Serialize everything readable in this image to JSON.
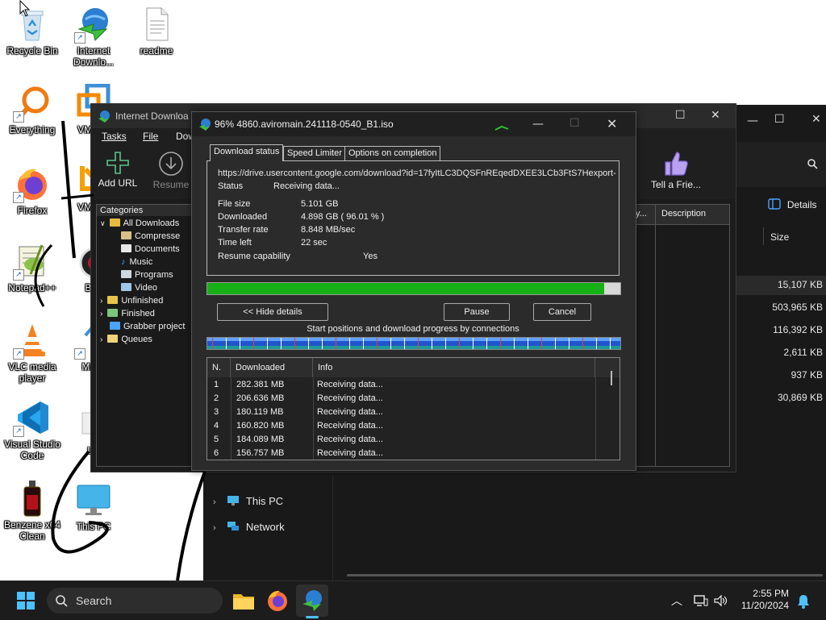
{
  "desktop": {
    "icons": [
      {
        "label": "Recycle Bin"
      },
      {
        "label": "Internet Downlo..."
      },
      {
        "label": "readme"
      },
      {
        "label": "Everything"
      },
      {
        "label": "VMWor"
      },
      {
        "label": "Firefox"
      },
      {
        "label": "VMWor"
      },
      {
        "label": "Notepad++"
      },
      {
        "label": "Ban"
      },
      {
        "label": "VLC media player"
      },
      {
        "label": "Maku"
      },
      {
        "label": "Visual Studio Code"
      },
      {
        "label": "Un"
      },
      {
        "label": "Benzene x64 Clean"
      },
      {
        "label": "This PC"
      }
    ]
  },
  "explorer": {
    "details_label": "Details",
    "size_header": "Size",
    "sizes": [
      "15,107 KB",
      "503,965 KB",
      "116,392 KB",
      "2,611 KB",
      "937 KB",
      "30,869 KB"
    ],
    "nav": [
      {
        "label": "This PC"
      },
      {
        "label": "Network"
      }
    ]
  },
  "idm": {
    "title": "Internet Downloa",
    "menu": [
      "Tasks",
      "File",
      "Dow"
    ],
    "toolbar": {
      "add_url": "Add URL",
      "resume": "Resume",
      "tell_friend": "Tell a Frie..."
    },
    "categories": {
      "header": "Categories",
      "items": [
        {
          "label": "All Downloads"
        },
        {
          "label": "Compresse"
        },
        {
          "label": "Documents"
        },
        {
          "label": "Music"
        },
        {
          "label": "Programs"
        },
        {
          "label": "Video"
        },
        {
          "label": "Unfinished"
        },
        {
          "label": "Finished"
        },
        {
          "label": "Grabber project"
        },
        {
          "label": "Queues"
        }
      ]
    },
    "list": {
      "col_description": "Description",
      "col_partial": "y..."
    }
  },
  "dialog": {
    "title": "96% 4860.aviromain.241118-0540_B1.iso",
    "tabs": [
      "Download status",
      "Speed Limiter",
      "Options on completion"
    ],
    "url": "https://drive.usercontent.google.com/download?id=17fyItLC3DQSFnREqedDXEE3LCb3FtS7Hexport-",
    "fields": [
      {
        "key": "Status",
        "value": "Receiving data..."
      },
      {
        "key": "File size",
        "value": "5.101  GB"
      },
      {
        "key": "Downloaded",
        "value": "4.898  GB  ( 96.01 % )"
      },
      {
        "key": "Transfer rate",
        "value": "8.848  MB/sec"
      },
      {
        "key": "Time left",
        "value": "22 sec"
      },
      {
        "key": "Resume capability",
        "value": "Yes"
      }
    ],
    "progress_fraction": 0.9601,
    "buttons": {
      "hide_details": "<< Hide details",
      "pause": "Pause",
      "cancel": "Cancel"
    },
    "connections_caption": "Start positions and download progress by connections",
    "table": {
      "headers": [
        "N.",
        "Downloaded",
        "Info"
      ],
      "rows": [
        {
          "n": "1",
          "downloaded": "282.381  MB",
          "info": "Receiving data..."
        },
        {
          "n": "2",
          "downloaded": "206.636  MB",
          "info": "Receiving data..."
        },
        {
          "n": "3",
          "downloaded": "180.119  MB",
          "info": "Receiving data..."
        },
        {
          "n": "4",
          "downloaded": "160.820  MB",
          "info": "Receiving data..."
        },
        {
          "n": "5",
          "downloaded": "184.089  MB",
          "info": "Receiving data..."
        },
        {
          "n": "6",
          "downloaded": "156.757  MB",
          "info": "Receiving data..."
        }
      ]
    }
  },
  "taskbar": {
    "search_placeholder": "Search",
    "time": "2:55 PM",
    "date": "11/20/2024"
  },
  "colors": {
    "progress_green": "#16b016",
    "accent": "#0078d4"
  }
}
